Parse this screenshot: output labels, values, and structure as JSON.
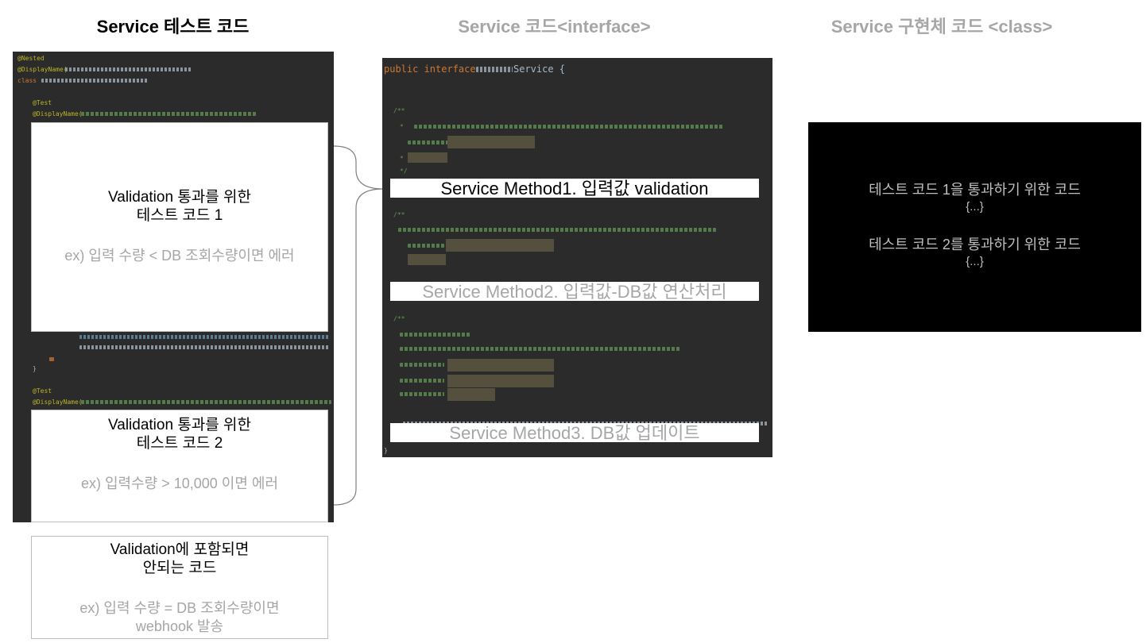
{
  "headings": {
    "test_code": "Service 테스트 코드",
    "interface_code": "Service 코드<interface>",
    "impl_code": "Service 구현체 코드 <class>"
  },
  "test_panel": {
    "line_nested": "@Nested",
    "line_display1": "@DisplayName(",
    "line_class": "class",
    "line_test1": "@Test",
    "line_display2": "@DisplayName(",
    "line_brace": "}",
    "line_test2": "@Test",
    "line_display3": "@DisplayName("
  },
  "test_boxes": [
    {
      "title1": "Validation 통과를 위한",
      "title2": "테스트 코드 1",
      "example": "ex) 입력 수량 < DB 조회수량이면 에러"
    },
    {
      "title1": "Validation 통과를 위한",
      "title2": "테스트 코드 2",
      "example": "ex) 입력수량 > 10,000 이면 에러"
    }
  ],
  "outside_box": {
    "title1": "Validation에 포함되면",
    "title2": "안되는 코드",
    "example1": "ex) 입력 수량 = DB 조회수량이면",
    "example2": "webhook 발송"
  },
  "interface_panel": {
    "decl_public": "public interface",
    "decl_name": "Service {",
    "doc_open": "/**",
    "doc_star": "*",
    "doc_close": "*/",
    "closing_brace": "}"
  },
  "methods": [
    {
      "label": "Service Method1. 입력값 validation",
      "color": "#000000"
    },
    {
      "label": "Service Method2. 입력값-DB값 연산처리",
      "color": "#a6a6a6"
    },
    {
      "label": "Service Method3. DB값 업데이트",
      "color": "#a6a6a6"
    }
  ],
  "impl_panel": {
    "line1": "테스트 코드 1을 통과하기 위한 코드",
    "ellipsis1": "{...}",
    "line2": "테스트 코드 2를 통과하기 위한 코드",
    "ellipsis2": "{...}"
  },
  "colors": {
    "annotation": "#bbb529",
    "keyword": "#cc7832",
    "comment": "#629755",
    "editor_bg": "#2b2b2b",
    "dim_text": "#a6a6a6"
  }
}
